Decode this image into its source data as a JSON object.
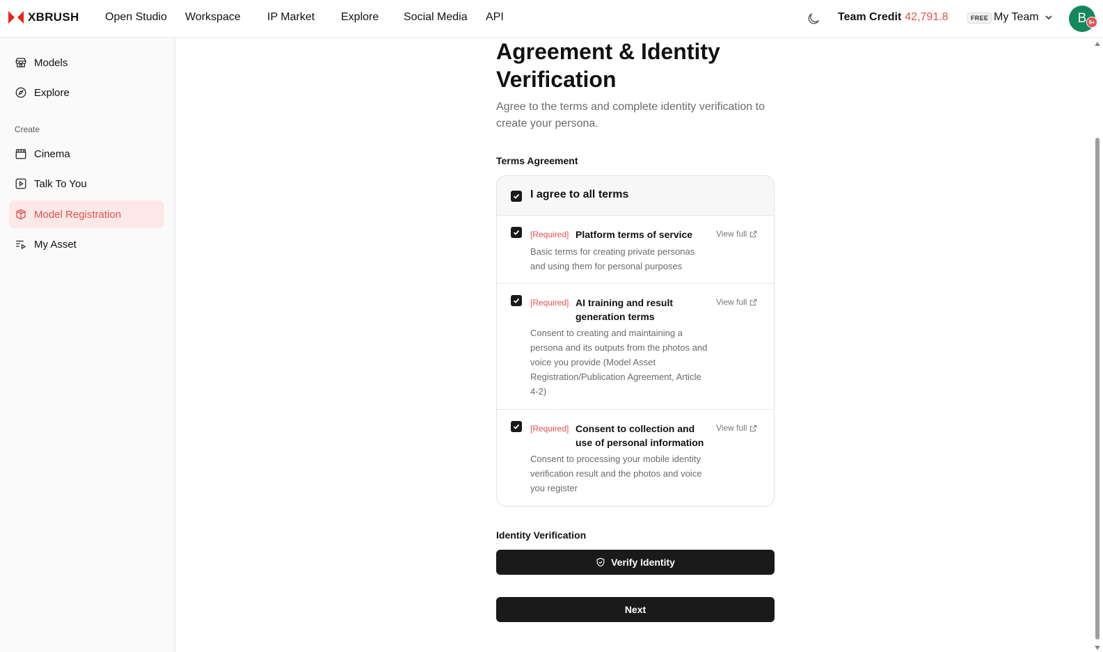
{
  "header": {
    "brand": "XBRUSH",
    "nav": [
      "Open Studio",
      "Workspace",
      "IP Market",
      "Explore",
      "Social Media",
      "API"
    ],
    "credit_label": "Team Credit",
    "credit_value": "42,791.8",
    "plan_badge": "FREE",
    "team_name": "My Team",
    "avatar_letter": "B",
    "notification_count": "9+"
  },
  "sidebar": {
    "items": [
      {
        "label": "Models",
        "icon": "store-icon"
      },
      {
        "label": "Explore",
        "icon": "compass-icon"
      }
    ],
    "section_label": "Create",
    "create_items": [
      {
        "label": "Cinema",
        "icon": "clapperboard-icon"
      },
      {
        "label": "Talk To You",
        "icon": "play-square-icon"
      },
      {
        "label": "Model Registration",
        "icon": "box-icon",
        "active": true
      },
      {
        "label": "My Asset",
        "icon": "list-play-icon"
      }
    ]
  },
  "main": {
    "title": "Agreement & Identity Verification",
    "subtitle": "Agree to the terms and complete identity verification to create your persona.",
    "terms_label": "Terms Agreement",
    "agree_all": "I agree to all terms",
    "terms": [
      {
        "tag": "[Required]",
        "title": "Platform terms of service",
        "desc": "Basic terms for creating private personas and using them for personal purposes",
        "link": "View full"
      },
      {
        "tag": "[Required]",
        "title": "AI training and result generation terms",
        "desc": "Consent to creating and maintaining a persona and its outputs from the photos and voice you provide (Model Asset Registration/Publication Agreement, Article 4-2)",
        "link": "View full"
      },
      {
        "tag": "[Required]",
        "title": "Consent to collection and use of personal information",
        "desc": "Consent to processing your mobile identity verification result and the photos and voice you register",
        "link": "View full"
      }
    ],
    "identity_label": "Identity Verification",
    "verify_button": "Verify Identity",
    "next_button": "Next"
  },
  "colors": {
    "accent": "#e2504f",
    "avatar": "#13875e",
    "button": "#1a1a1a",
    "active_bg": "#fde8e8"
  }
}
